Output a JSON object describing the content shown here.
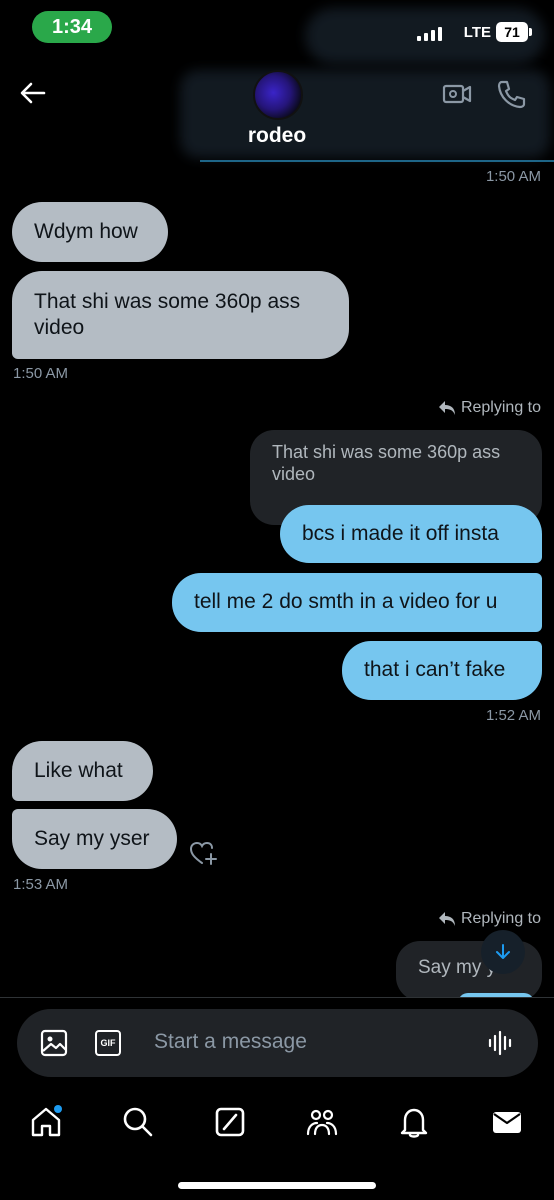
{
  "status_bar": {
    "time": "1:34",
    "network": "LTE",
    "battery": "71"
  },
  "header": {
    "contact_name": "rodeo"
  },
  "messages": {
    "ts_1": "1:50 AM",
    "r1": "Wdym how",
    "r2_line1": "That shi was some 360p ass",
    "r2_line2": "video",
    "ts_2": "1:50 AM",
    "reply_label_1": "Replying to",
    "quote_1_line1": "That shi was some 360p ass",
    "quote_1_line2": "video",
    "s1": "bcs i made it off insta",
    "s2": "tell me 2 do smth in a video for u",
    "s3": "that i can’t fake",
    "ts_3": "1:52 AM",
    "r3": "Like what",
    "r4": "Say my yser",
    "ts_4": "1:53 AM",
    "reply_label_2": "Replying to",
    "quote_2_partial": "Say my y"
  },
  "composer": {
    "placeholder": "Start a message",
    "gif_label": "GIF"
  },
  "colors": {
    "sent_bubble": "#76c6ef",
    "received_bubble": "#b4bcc4",
    "accent": "#1d9bf0"
  },
  "tabs": [
    "home-icon",
    "search-icon",
    "grok-icon",
    "communities-icon",
    "notifications-icon",
    "messages-icon"
  ]
}
